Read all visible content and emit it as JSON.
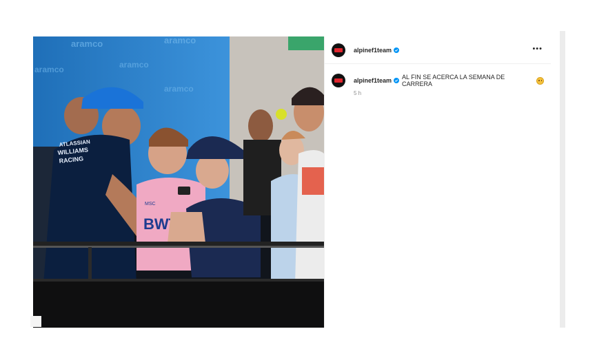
{
  "post": {
    "author": {
      "username": "alpinef1team",
      "verified": true,
      "avatar_icon": "alpine-logo-icon"
    },
    "more_options_label": "•••",
    "caption": {
      "username": "alpinef1team",
      "text": "AL FIN SE ACERCA LA SEMANA DE CARRERA",
      "emoji_icon": "grinning-face-icon",
      "timestamp": "5 h"
    },
    "photo": {
      "description_icon": "photo-drivers-paddock",
      "printed_texts": [
        "ATLASSIAN",
        "WILLIAMS",
        "RACING",
        "BWT",
        "MSC"
      ]
    }
  },
  "colors": {
    "verified_blue": "#0095f6",
    "brand_red": "#e2262f",
    "williams_navy": "#0b1f3f",
    "williams_cap": "#1a73d8",
    "bwt_pink": "#f0a9c3"
  }
}
